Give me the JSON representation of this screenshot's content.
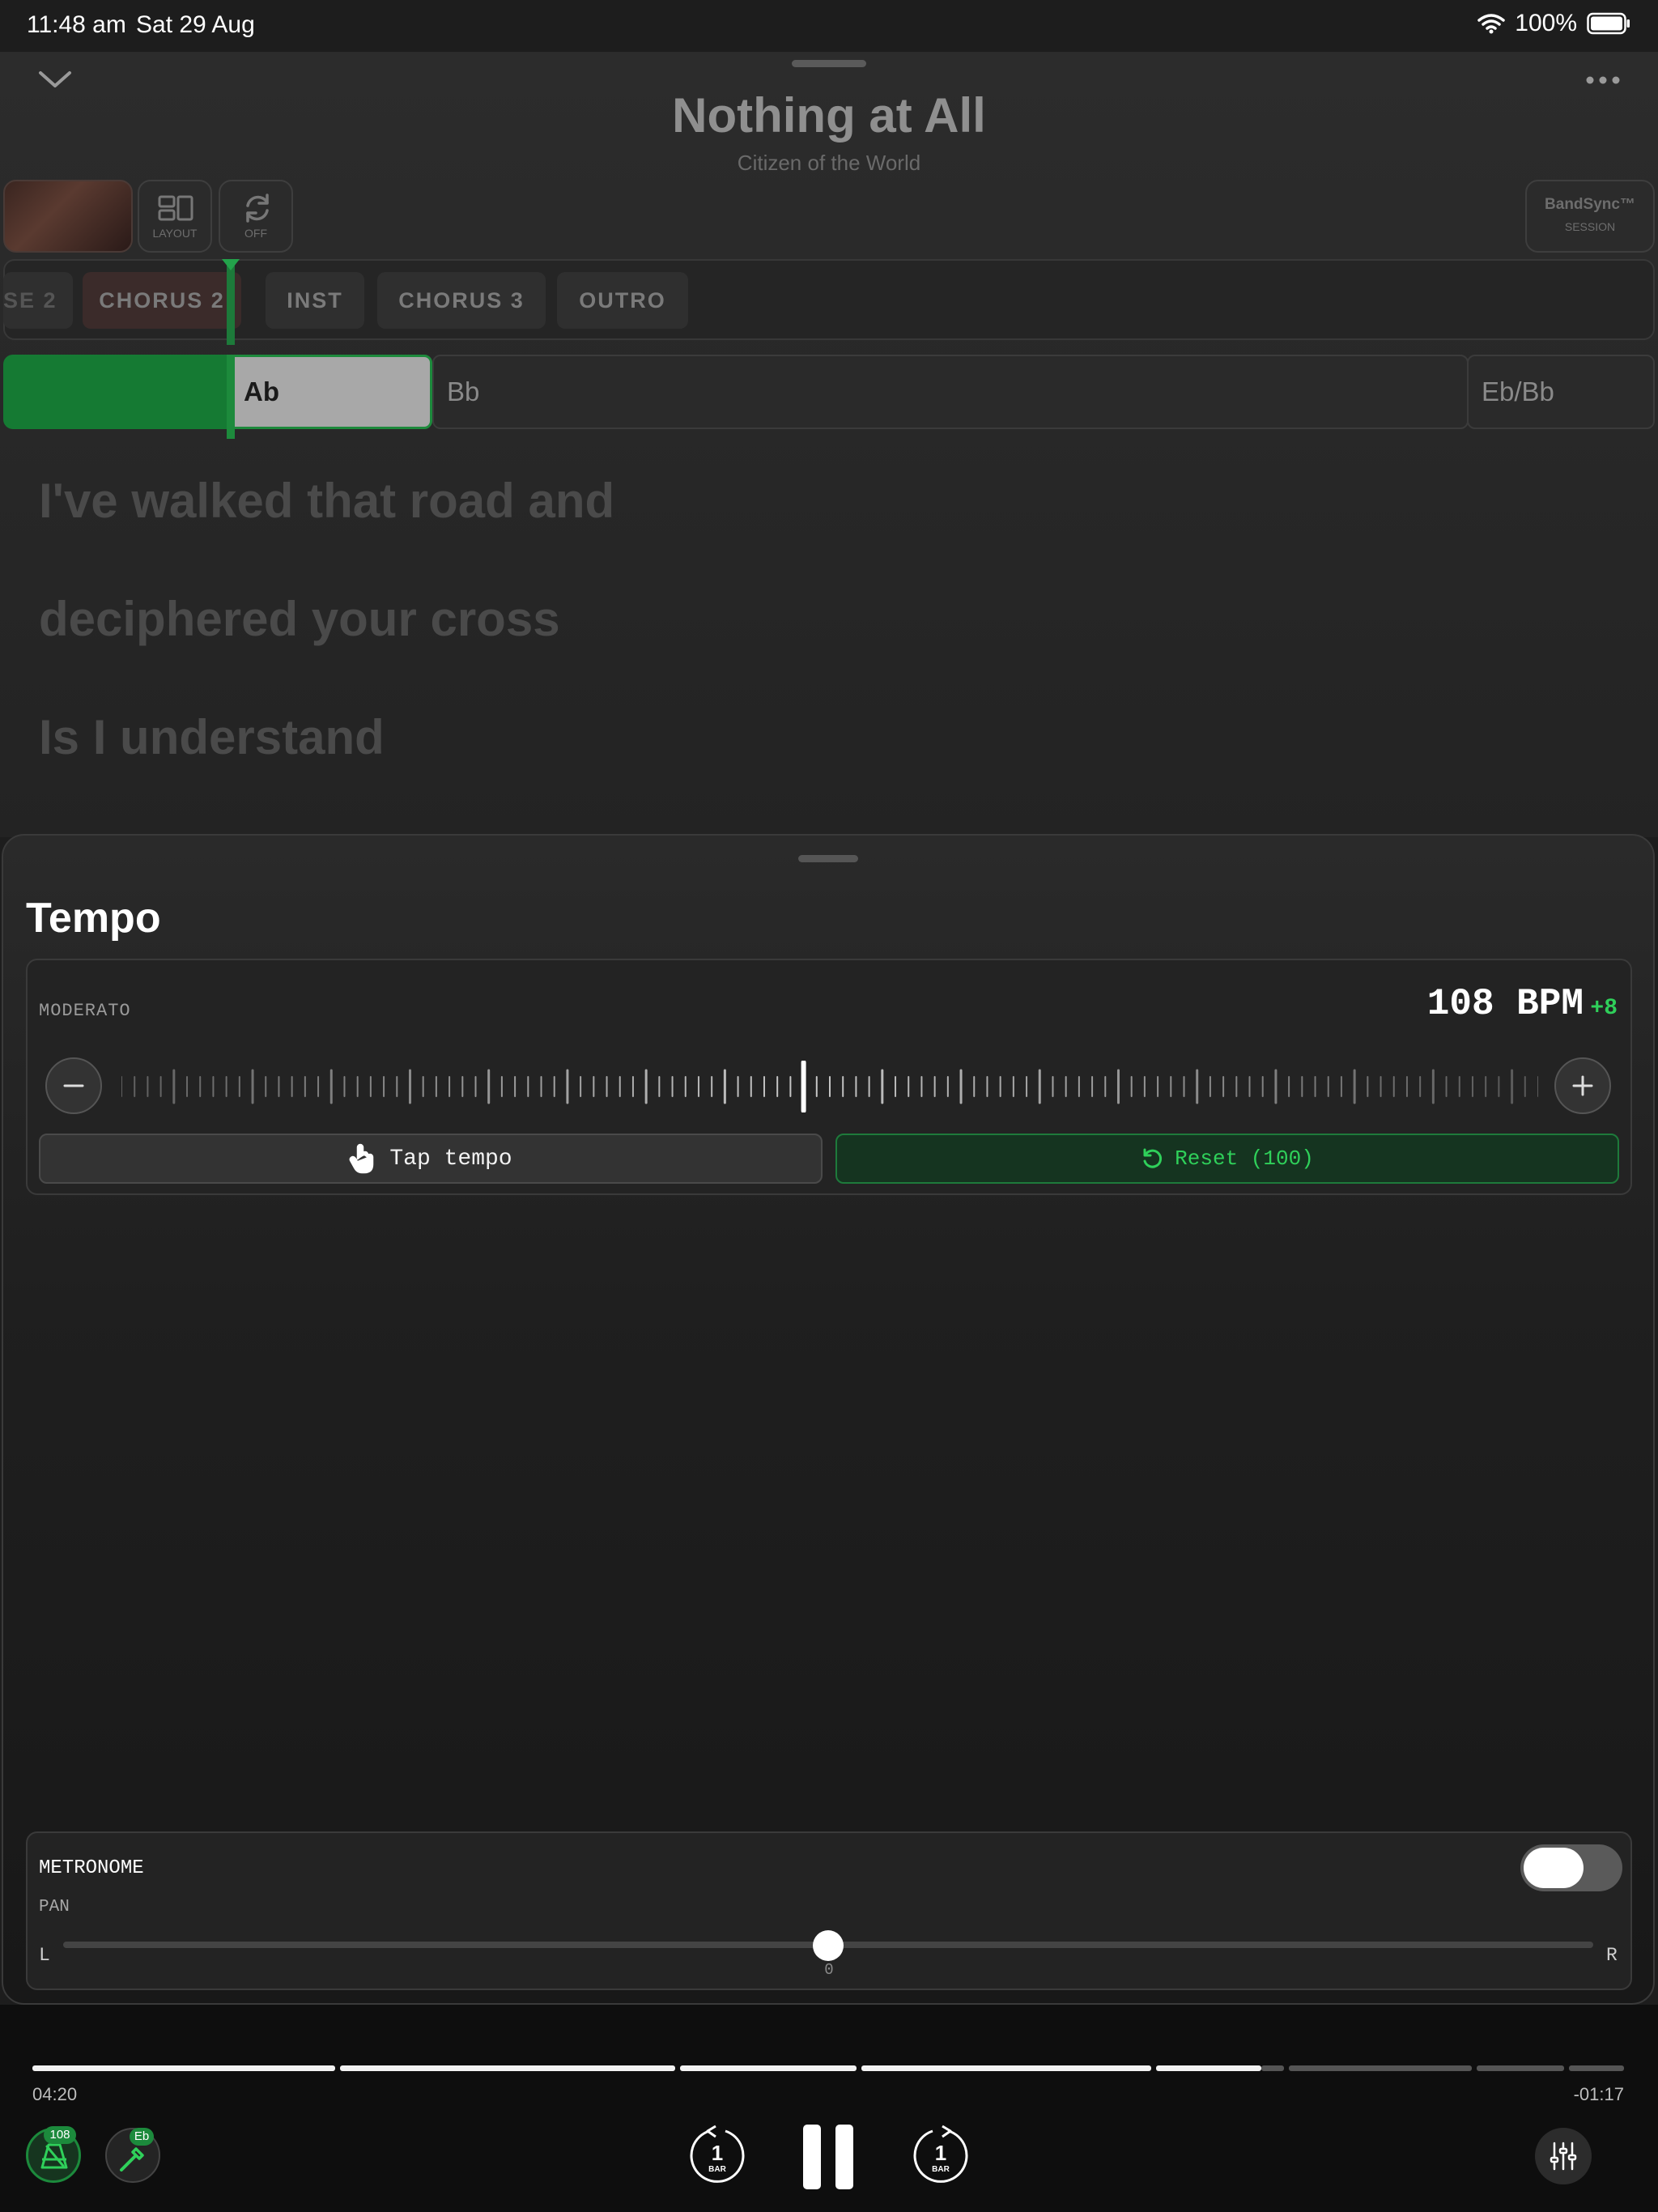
{
  "status_bar": {
    "time": "11:48 am",
    "date": "Sat 29 Aug",
    "battery": "100%"
  },
  "song": {
    "title": "Nothing at All",
    "artist": "Citizen of the World"
  },
  "toolbar": {
    "layout_label": "LAYOUT",
    "loop_label": "OFF",
    "bandsync_title": "BandSync™",
    "bandsync_subtitle": "SESSION"
  },
  "sections": [
    "SE 2",
    "CHORUS 2",
    "INST",
    "CHORUS 3",
    "OUTRO"
  ],
  "chords": [
    "Ab",
    "Bb",
    "Eb/Bb"
  ],
  "lyrics": [
    "I've walked that road and",
    "deciphered your cross",
    "Is I understand"
  ],
  "tempo_sheet": {
    "title": "Tempo",
    "marking": "MODERATO",
    "bpm": "108 BPM",
    "delta": "+8",
    "tap_label": "Tap tempo",
    "reset_label": "Reset (100)"
  },
  "metronome": {
    "label": "METRONOME",
    "pan_label": "PAN",
    "enabled": false,
    "pan_left": "L",
    "pan_right": "R",
    "pan_value": "0"
  },
  "transport": {
    "elapsed": "04:20",
    "remaining": "-01:17",
    "tempo_badge": "108",
    "key_badge": "Eb",
    "bar_back": "1",
    "bar_fwd": "1",
    "bar_unit": "BAR"
  },
  "colors": {
    "accent": "#2fd05a",
    "accent_dark": "#1c8a3c"
  }
}
